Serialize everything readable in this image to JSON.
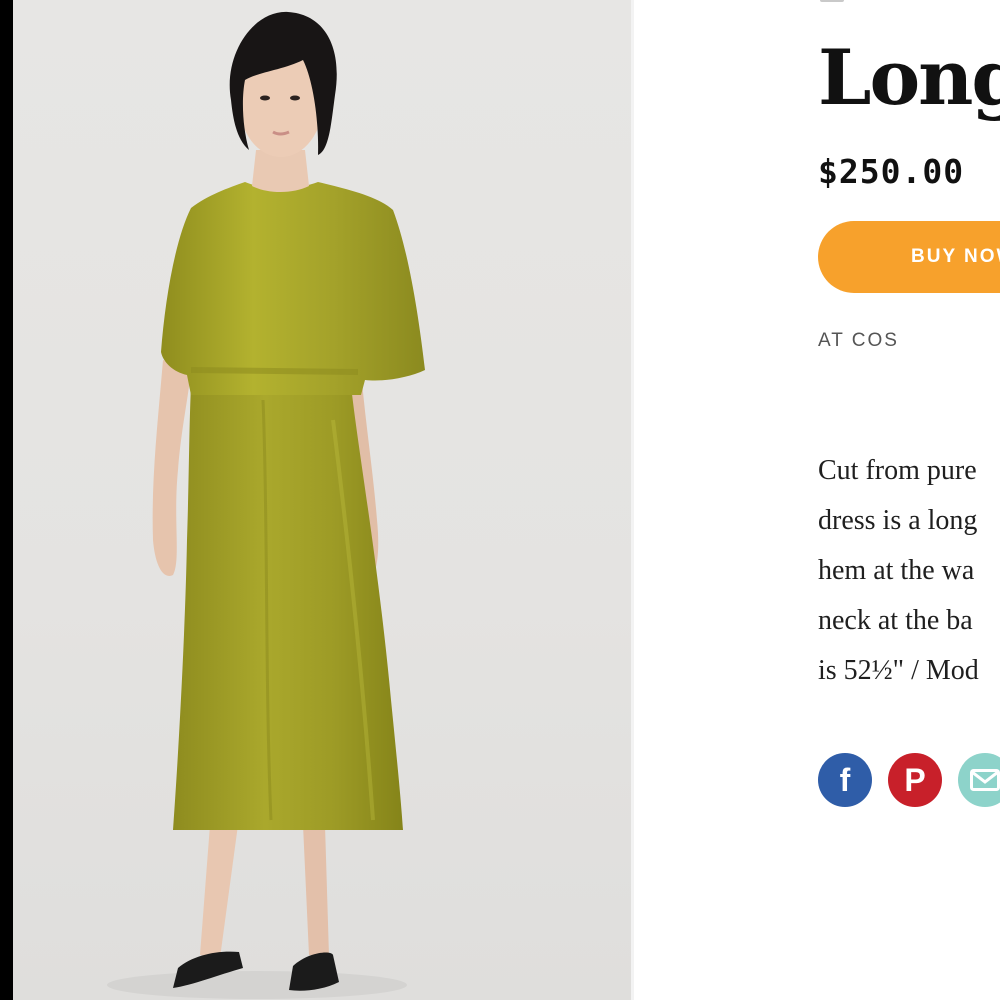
{
  "product": {
    "title": "Long",
    "price": "$250.00",
    "buy_label": "BUY NOW",
    "retailer": "AT COS",
    "description_lines": [
      "Cut from pure",
      "dress is a long",
      "hem at the wa",
      "neck at the ba",
      "is 52½\" / Mod"
    ]
  },
  "share": {
    "facebook_glyph": "f",
    "pinterest_glyph": "P",
    "icons": [
      "facebook-icon",
      "pinterest-icon",
      "email-icon"
    ]
  },
  "colors": {
    "accent_button": "#f7a12c",
    "facebook": "#2f5da8",
    "pinterest": "#c8202a",
    "email": "#8dd3ca",
    "dress": "#a7a528"
  }
}
